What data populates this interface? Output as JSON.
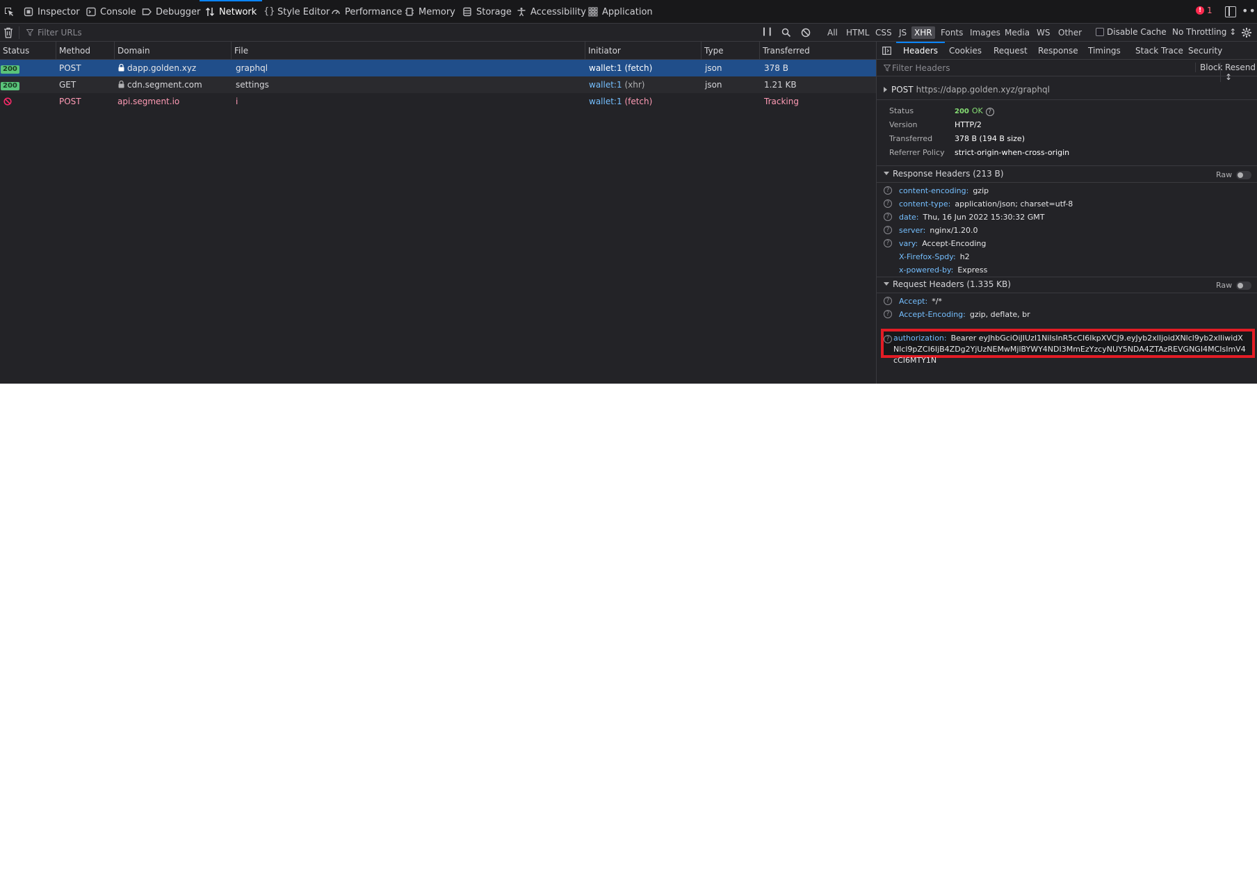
{
  "toolbar": {
    "tabs": [
      {
        "label": "Inspector",
        "icon": "inspector-icon"
      },
      {
        "label": "Console",
        "icon": "console-icon"
      },
      {
        "label": "Debugger",
        "icon": "debugger-icon"
      },
      {
        "label": "Network",
        "icon": "network-icon",
        "selected": true
      },
      {
        "label": "Style Editor",
        "icon": "style-editor-icon"
      },
      {
        "label": "Performance",
        "icon": "performance-icon"
      },
      {
        "label": "Memory",
        "icon": "memory-icon"
      },
      {
        "label": "Storage",
        "icon": "storage-icon"
      },
      {
        "label": "Accessibility",
        "icon": "accessibility-icon"
      },
      {
        "label": "Application",
        "icon": "application-icon"
      }
    ],
    "error_count": "1"
  },
  "filter": {
    "placeholder": "Filter URLs",
    "types": [
      "All",
      "HTML",
      "CSS",
      "JS",
      "XHR",
      "Fonts",
      "Images",
      "Media",
      "WS",
      "Other"
    ],
    "active_type": "XHR",
    "disable_cache_label": "Disable Cache",
    "throttling": "No Throttling ↕"
  },
  "table": {
    "columns": [
      "Status",
      "Method",
      "Domain",
      "File",
      "Initiator",
      "Type",
      "Transferred"
    ],
    "rows": [
      {
        "status": "200",
        "method": "POST",
        "domain": "dapp.golden.xyz",
        "file": "graphql",
        "initiator": "wallet:1",
        "cause": "(fetch)",
        "type": "json",
        "transferred": "378 B"
      },
      {
        "status": "200",
        "method": "GET",
        "domain": "cdn.segment.com",
        "file": "settings",
        "initiator": "wallet:1",
        "cause": "(xhr)",
        "type": "json",
        "transferred": "1.21 KB"
      },
      {
        "status": "",
        "method": "POST",
        "domain": "api.segment.io",
        "file": "i",
        "initiator": "wallet:1",
        "cause": "(fetch)",
        "type": "",
        "transferred": "Tracking"
      }
    ]
  },
  "panel": {
    "tabs": [
      "Headers",
      "Cookies",
      "Request",
      "Response",
      "Timings",
      "Stack Trace",
      "Security"
    ],
    "filter_placeholder": "Filter Headers",
    "block_label": "Block",
    "resend_label": "Resend ↕",
    "summary": {
      "method": "POST",
      "url": "https://dapp.golden.xyz/graphql"
    },
    "details": {
      "status_label": "Status",
      "status_code": "200",
      "status_text": "OK",
      "version_label": "Version",
      "version": "HTTP/2",
      "transferred_label": "Transferred",
      "transferred": "378 B (194 B size)",
      "referrer_label": "Referrer Policy",
      "referrer": "strict-origin-when-cross-origin"
    },
    "response_headers": {
      "title": "Response Headers (213 B)",
      "raw_label": "Raw",
      "items": [
        {
          "key": "content-encoding:",
          "value": "gzip"
        },
        {
          "key": "content-type:",
          "value": "application/json; charset=utf-8"
        },
        {
          "key": "date:",
          "value": "Thu, 16 Jun 2022 15:30:32 GMT"
        },
        {
          "key": "server:",
          "value": "nginx/1.20.0"
        },
        {
          "key": "vary:",
          "value": "Accept-Encoding"
        },
        {
          "key": "X-Firefox-Spdy:",
          "value": "h2"
        },
        {
          "key": "x-powered-by:",
          "value": "Express"
        }
      ]
    },
    "request_headers": {
      "title": "Request Headers (1.335 KB)",
      "raw_label": "Raw",
      "items": [
        {
          "key": "Accept:",
          "value": "*/*"
        },
        {
          "key": "Accept-Encoding:",
          "value": "gzip, deflate, br"
        }
      ],
      "authorization": {
        "key": "authorization:",
        "value": "Bearer eyJhbGciOiJIUzI1NiIsInR5cCI6IkpXVCJ9.eyJyb2xlIjoidXNlcl9yb2xlIiwidXNlcl9pZCI6IjB4ZDg2YjUzNEMwMjlBYWY4NDI3MmEzYzcyNUY5NDA4ZTAzREVGNGI4MCIsImV4cCI6MTY1N"
      }
    }
  }
}
